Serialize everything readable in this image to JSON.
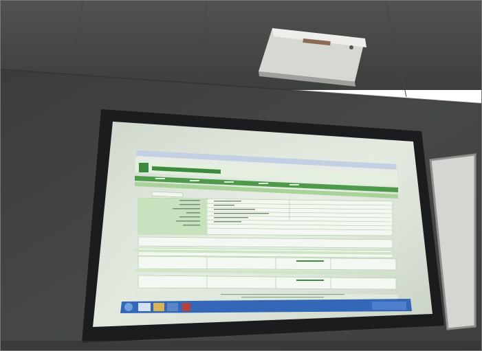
{
  "scene": {
    "description_free": true,
    "projector": {
      "brand_text": ""
    },
    "screen": {
      "browser": {
        "title_bar": "",
        "menu_items": [
          "",
          "",
          "",
          ""
        ]
      },
      "portal": {
        "logo_glyph": "",
        "site_title": "",
        "nav_items": [
          "",
          "",
          "",
          "",
          ""
        ],
        "section_title": "",
        "tab_label": "",
        "form_labels": [
          "",
          "",
          "",
          "",
          "",
          "",
          "",
          "",
          "",
          ""
        ],
        "sub_section_1": "",
        "sub_section_2": "",
        "footer_lines": [
          "",
          ""
        ]
      },
      "taskbar": {
        "clock": ""
      }
    }
  },
  "colors": {
    "wall": "#3f423f",
    "ceiling": "#4a4d4a",
    "screen_bezel": "#1b1c1d",
    "screen_surface": "#d9e3d6",
    "portal_green": "#3e8a3c",
    "portal_light_green": "#9fcd8f",
    "taskbar": "#3467b8",
    "projector": "#d7d8d2"
  }
}
